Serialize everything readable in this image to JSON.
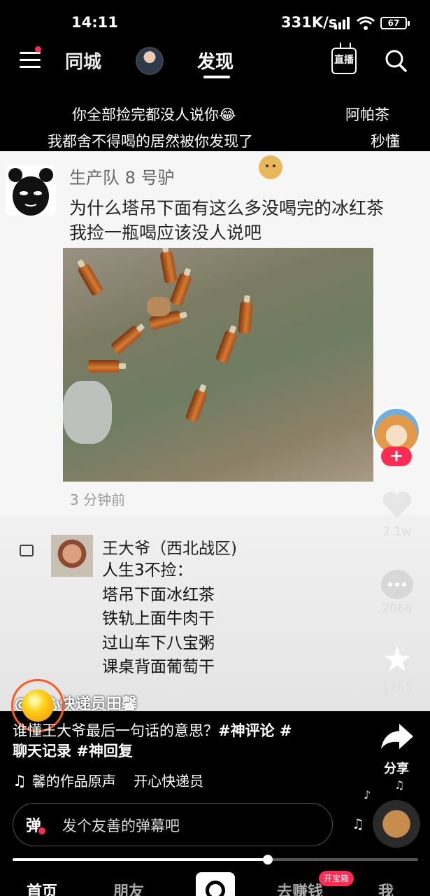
{
  "status_bar": {
    "time": "14:11",
    "network_speed": "331K/s",
    "battery": "67"
  },
  "top_nav": {
    "tab_city": "同城",
    "tab_discover": "发现",
    "live_label": "直播"
  },
  "danmaku": [
    {
      "text": "你全部捡完都没人说你😂"
    },
    {
      "text": "阿帕茶"
    },
    {
      "text": "我都舍不得喝的居然被你发现了"
    },
    {
      "text": "秒懂"
    }
  ],
  "post": {
    "username": "生产队 8 号驴",
    "line1": "为什么塔吊下面有这么多没喝完的冰红茶",
    "line2": "我捡一瓶喝应该没人说吧",
    "time": "3 分钟前"
  },
  "reply": {
    "username": "王大爷（西北战区)",
    "lines": [
      "人生3不捡：",
      "塔吊下面冰红茶",
      "铁轨上面牛肉干",
      "过山车下八宝粥",
      "课桌背面葡萄干"
    ]
  },
  "creator_name": "@开心快递员田馨",
  "sidebar": {
    "likes": "2.1w",
    "comments": "2068",
    "favorites": "1265",
    "share_label": "分享"
  },
  "caption": {
    "text": "谁懂王大爷最后一句话的意思？",
    "tags_line1": "#神评论 #",
    "tags_line2": "聊天记录 #神回复"
  },
  "music": {
    "title": "馨的作品原声",
    "author": "开心快递员"
  },
  "danmu_input": {
    "icon_label": "弹",
    "placeholder": "发个友善的弹幕吧"
  },
  "playback": {
    "progress_fraction": 0.63
  },
  "bottom_nav": {
    "home": "首页",
    "friends": "朋友",
    "earn": "去赚钱",
    "earn_badge": "开宝箱",
    "me": "我"
  },
  "colors": {
    "accent": "#fe2c55",
    "background": "#000000"
  }
}
